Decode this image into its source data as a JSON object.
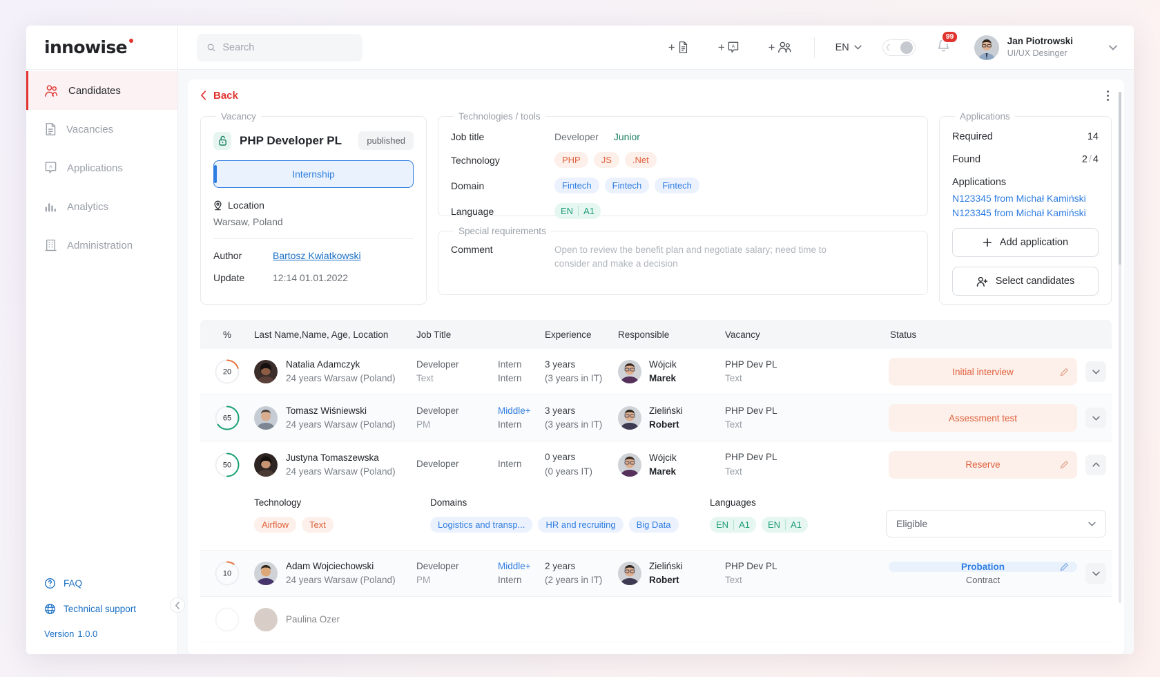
{
  "header": {
    "logo": "innowise",
    "search": {
      "placeholder": "Search",
      "value": ""
    },
    "add_actions": [
      {
        "name": "add-document",
        "label": "+"
      },
      {
        "name": "add-application",
        "label": "+"
      },
      {
        "name": "add-candidate",
        "label": "+"
      }
    ],
    "language": "EN",
    "notifications_count": "99",
    "user": {
      "name": "Jan Piotrowski",
      "role": "UI/UX Desinger"
    }
  },
  "sidebar": {
    "items": [
      {
        "label": "Candidates",
        "icon": "people-icon",
        "active": true
      },
      {
        "label": "Vacancies",
        "icon": "document-icon",
        "active": false
      },
      {
        "label": "Applications",
        "icon": "application-icon",
        "active": false
      },
      {
        "label": "Analytics",
        "icon": "chart-icon",
        "active": false
      },
      {
        "label": "Administration",
        "icon": "building-icon",
        "active": false
      }
    ],
    "faq": "FAQ",
    "support": "Technical support",
    "version_label": "Version",
    "version_value": "1.0.0"
  },
  "topbar": {
    "back": "Back"
  },
  "vacancy": {
    "legend": "Vacancy",
    "title": "PHP Developer PL",
    "status_badge": "published",
    "type_button": "Internship",
    "location_label": "Location",
    "location_value": "Warsaw, Poland",
    "author_label": "Author",
    "author_value": "Bartosz Kwiatkowski",
    "update_label": "Update",
    "update_value": "12:14 01.01.2022"
  },
  "technologies": {
    "legend": "Technologies / tools",
    "job_title_label": "Job  title",
    "job_title_value": "Developer",
    "job_title_level": "Junior",
    "technology_label": "Technology",
    "technology_tags": [
      "PHP",
      "JS",
      ".Net"
    ],
    "domain_label": "Domain",
    "domain_tags": [
      "Fintech",
      "Fintech",
      "Fintech"
    ],
    "language_label": "Language",
    "language_tag": {
      "lang": "EN",
      "level": "A1"
    }
  },
  "special": {
    "legend": "Special requirements",
    "comment_label": "Comment",
    "comment_value": "Open to review the benefit plan and negotiate salary; need time to consider and make a decision"
  },
  "applications": {
    "legend": "Applications",
    "required_label": "Required",
    "required_value": "14",
    "found_label": "Found",
    "found_current": "2",
    "found_sep": "/",
    "found_total": "4",
    "applications_label": "Applications",
    "links": [
      "N123345 from Michał Kamiński",
      "N123345 from Michał Kamiński"
    ],
    "add_application_button": "Add application",
    "select_candidates_button": "Select candidates"
  },
  "table": {
    "columns": [
      "%",
      "Last Name,Name, Age, Location",
      "Job Title",
      "Experience",
      "Responsible",
      "Vacancy",
      "Status"
    ],
    "rows": [
      {
        "pct": "20",
        "pct_color": "#e8703a",
        "name": "Natalia Adamczyk",
        "sub": "24 years Warsaw (Poland)",
        "job1": "Developer",
        "job2": "Text",
        "lvl1": "Intern",
        "lvl2": "Intern",
        "lvl_highlight": false,
        "exp1": "3 years",
        "exp2": "(3 years in IT)",
        "resp1": "Wójcik",
        "resp2": "Marek",
        "vac1": "PHP Dev PL",
        "vac2": "Text",
        "status": "Initial interview",
        "status_type": "orange",
        "status_sub": "",
        "caret": "down",
        "alt": false
      },
      {
        "pct": "65",
        "pct_color": "#16a070",
        "name": "Tomasz Wiśniewski",
        "sub": "24 years Warsaw (Poland)",
        "job1": "Developer",
        "job2": "PM",
        "lvl1": "Middle+",
        "lvl2": "Intern",
        "lvl_highlight": true,
        "exp1": "3 years",
        "exp2": "(3 years in IT)",
        "resp1": "Zieliński",
        "resp2": "Robert",
        "vac1": "PHP Dev PL",
        "vac2": "Text",
        "status": "Assessment test",
        "status_type": "orange-plain",
        "status_sub": "",
        "caret": "down",
        "alt": true
      },
      {
        "pct": "50",
        "pct_color": "#16a070",
        "name": "Justyna Tomaszewska",
        "sub": "24 years Warsaw (Poland)",
        "job1": "Developer",
        "job2": "",
        "lvl1": "Intern",
        "lvl2": "",
        "lvl_highlight": false,
        "exp1": "0 years",
        "exp2": "(0 years IT)",
        "resp1": "Wójcik",
        "resp2": "Marek",
        "vac1": "PHP Dev PL",
        "vac2": "Text",
        "status": "Reserve",
        "status_type": "orange",
        "status_sub": "",
        "caret": "up",
        "alt": false
      },
      {
        "pct": "10",
        "pct_color": "#e8703a",
        "name": "Adam Wojciechowski",
        "sub": "24 years Warsaw (Poland)",
        "job1": "Developer",
        "job2": "PM",
        "lvl1": "Middle+",
        "lvl2": "Intern",
        "lvl_highlight": true,
        "exp1": "2 years",
        "exp2": "(2 years in  IT)",
        "resp1": "Zieliński",
        "resp2": "Robert",
        "vac1": "PHP Dev PL",
        "vac2": "Text",
        "status": "Probation",
        "status_type": "blue",
        "status_sub": "Contract",
        "caret": "down",
        "alt": true
      }
    ],
    "expanded": {
      "technology_label": "Technology",
      "technology_tags": [
        "Airflow",
        "Text"
      ],
      "domains_label": "Domains",
      "domains_tags": [
        "Logistics and transp...",
        "HR and recruiting",
        "Big Data"
      ],
      "languages_label": "Languages",
      "languages_tags": [
        {
          "lang": "EN",
          "level": "A1"
        },
        {
          "lang": "EN",
          "level": "A1"
        }
      ],
      "select_value": "Eligible"
    }
  },
  "colors": {
    "brand_red": "#e1342f",
    "accent_blue": "#2f7de1",
    "accent_green": "#1f9c77",
    "accent_orange": "#e0603c"
  }
}
